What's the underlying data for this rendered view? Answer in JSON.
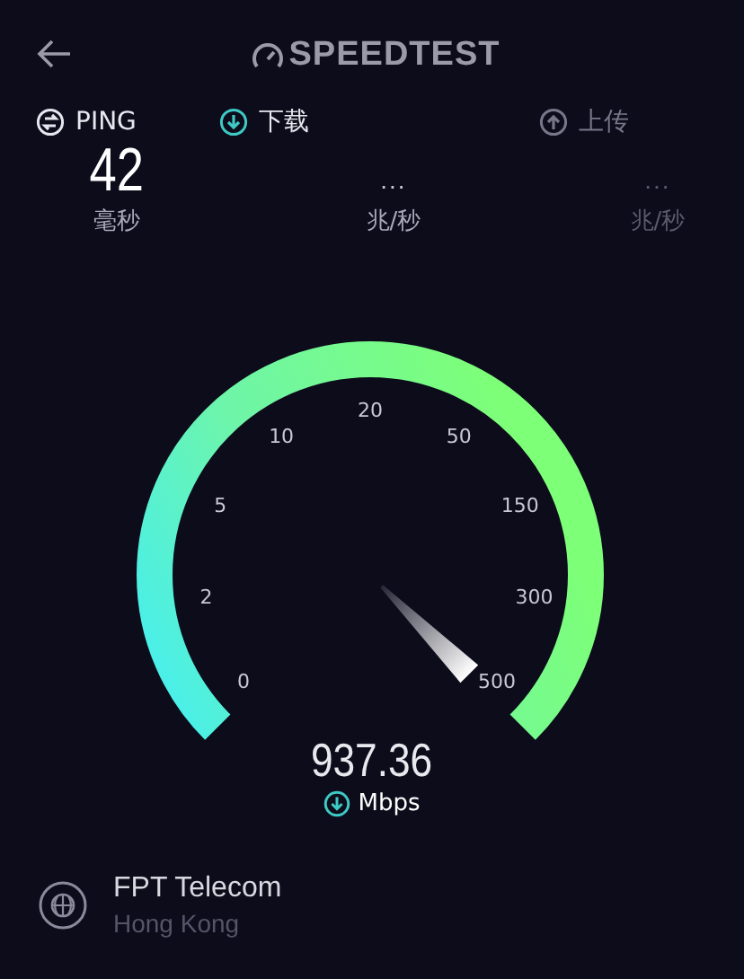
{
  "header": {
    "logo": "SPEEDTEST"
  },
  "stats": [
    {
      "label": "PING",
      "kind": "ping",
      "selected": false,
      "disabled": false,
      "value": "42",
      "unit": "毫秒"
    },
    {
      "label": "下载",
      "kind": "download",
      "selected": true,
      "disabled": false,
      "value": "...",
      "unit": "兆/秒"
    },
    {
      "label": "上传",
      "kind": "upload",
      "selected": false,
      "disabled": true,
      "value": "...",
      "unit": "兆/秒"
    }
  ],
  "gauge": {
    "ticks": [
      "0",
      "2",
      "5",
      "10",
      "20",
      "50",
      "150",
      "300",
      "500"
    ],
    "reading": "937.36",
    "unit": "Mbps"
  },
  "server": {
    "name": "FPT Telecom",
    "location": "Hong Kong"
  }
}
